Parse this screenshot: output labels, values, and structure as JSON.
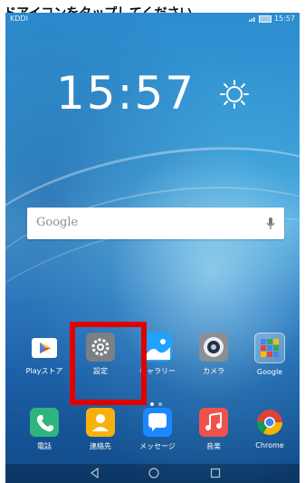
{
  "top_banner": {
    "text": "ドアイコンをタップしてください"
  },
  "status_bar": {
    "carrier": "KDDI",
    "time": "15:57"
  },
  "home": {
    "clock": "15:57",
    "weather_icon": "sun-icon",
    "search": {
      "placeholder": "Google",
      "mic_icon": "mic-icon"
    }
  },
  "apps_row": [
    {
      "label": "Playストア",
      "icon": "play-store-icon",
      "color": "#ffffff"
    },
    {
      "label": "設定",
      "icon": "settings-icon",
      "color": "#7b7f86"
    },
    {
      "label": "ギャラリー",
      "icon": "gallery-icon",
      "color": "#1fa3ff"
    },
    {
      "label": "カメラ",
      "icon": "camera-icon",
      "color": "#8a8f96"
    },
    {
      "label": "Google",
      "icon": "google-folder-icon",
      "color": "#ffffff"
    }
  ],
  "dock": [
    {
      "label": "電話",
      "icon": "phone-icon",
      "color": "#2db57c"
    },
    {
      "label": "連絡先",
      "icon": "contacts-icon",
      "color": "#f6b10f"
    },
    {
      "label": "メッセージ",
      "icon": "messages-icon",
      "color": "#1b88ff"
    },
    {
      "label": "音楽",
      "icon": "music-icon",
      "color": "#f0524b"
    },
    {
      "label": "Chrome",
      "icon": "chrome-icon",
      "color": "#ffffff"
    }
  ],
  "page_indicator": {
    "pages": 2,
    "current": 1
  },
  "nav": {
    "back_icon": "back-icon",
    "home_icon": "home-icon",
    "recents_icon": "recents-icon"
  },
  "colors": {
    "highlight": "#e00000"
  }
}
